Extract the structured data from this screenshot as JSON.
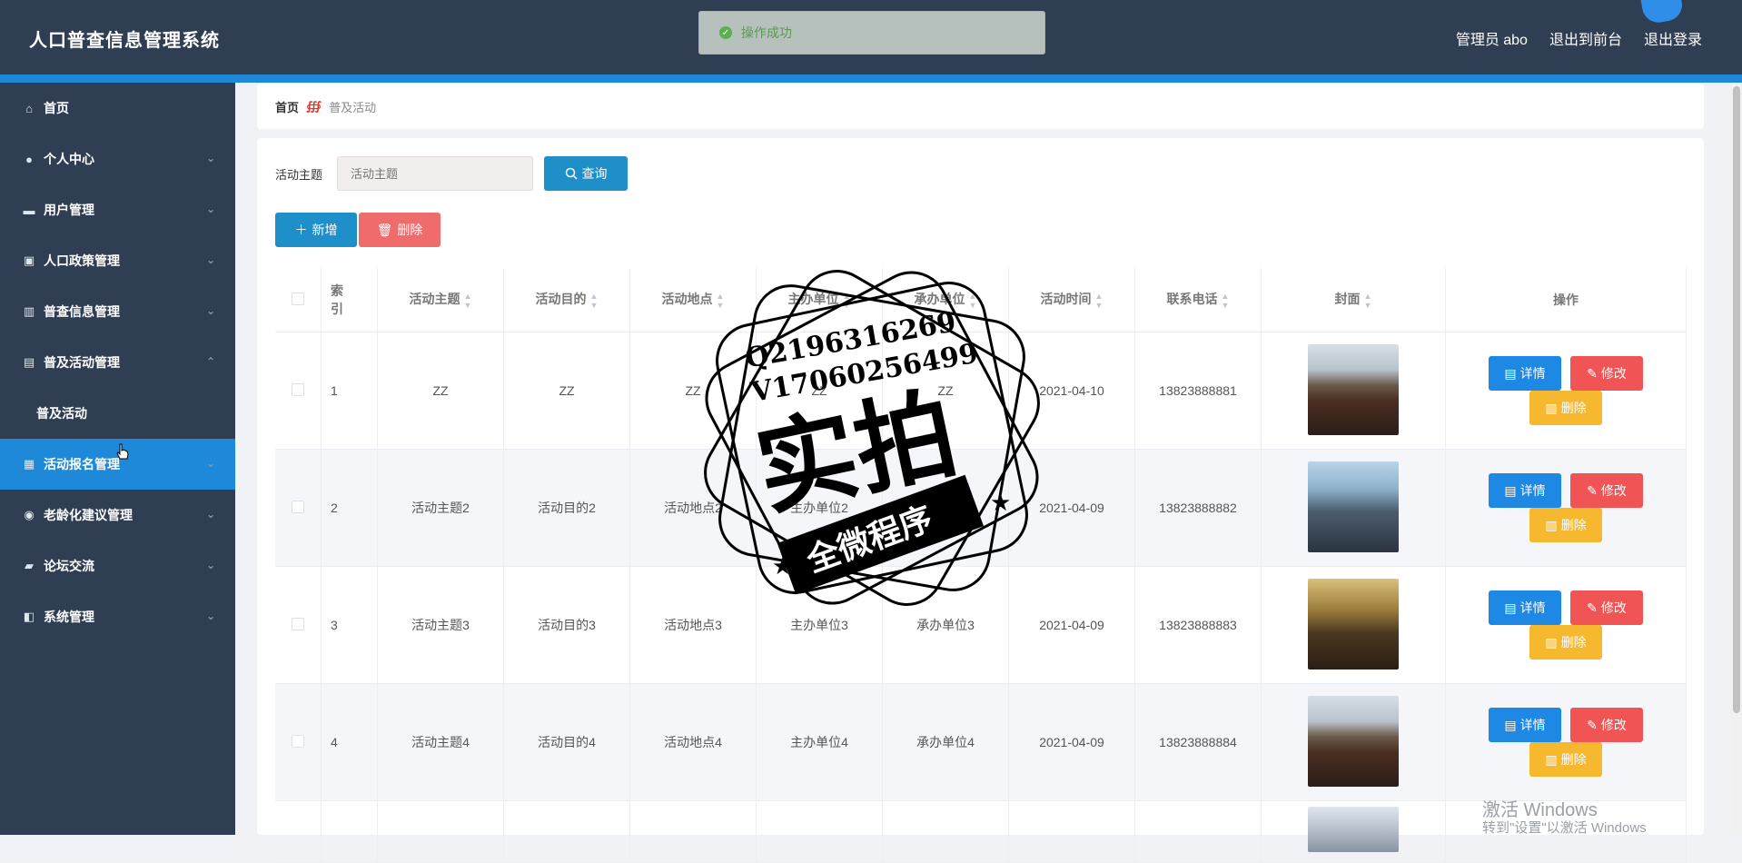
{
  "app": {
    "title": "人口普查信息管理系统"
  },
  "header": {
    "admin_label": "管理员 abo",
    "to_frontend": "退出到前台",
    "logout": "退出登录"
  },
  "toast": {
    "text": "操作成功"
  },
  "sidebar": {
    "items": [
      {
        "label": "首页",
        "icon": "home-icon"
      },
      {
        "label": "个人中心",
        "icon": "user-icon"
      },
      {
        "label": "用户管理",
        "icon": "monitor-icon"
      },
      {
        "label": "人口政策管理",
        "icon": "clipboard-icon"
      },
      {
        "label": "普查信息管理",
        "icon": "chart-icon"
      },
      {
        "label": "普及活动管理",
        "icon": "document-icon"
      },
      {
        "label": "普及活动",
        "icon": ""
      },
      {
        "label": "活动报名管理",
        "icon": "grid-icon"
      },
      {
        "label": "老龄化建议管理",
        "icon": "pin-icon"
      },
      {
        "label": "论坛交流",
        "icon": "briefcase-icon"
      },
      {
        "label": "系统管理",
        "icon": "settings-icon"
      }
    ]
  },
  "breadcrumb": {
    "home": "首页",
    "current": "普及活动"
  },
  "search": {
    "label": "活动主题",
    "placeholder": "活动主题",
    "button": "查询"
  },
  "toolbar": {
    "add": "新增",
    "delete": "删除"
  },
  "table": {
    "headers": [
      "索引",
      "活动主题",
      "活动目的",
      "活动地点",
      "主办单位",
      "承办单位",
      "活动时间",
      "联系电话",
      "封面",
      "操作"
    ],
    "rows": [
      {
        "index": "1",
        "theme": "ZZ",
        "purpose": "ZZ",
        "location": "ZZ",
        "organizer": "ZZ",
        "co_organizer": "ZZ",
        "time": "2021-04-10",
        "phone": "13823888881"
      },
      {
        "index": "2",
        "theme": "活动主题2",
        "purpose": "活动目的2",
        "location": "活动地点2",
        "organizer": "主办单位2",
        "co_organizer": "承办单位2",
        "time": "2021-04-09",
        "phone": "13823888882"
      },
      {
        "index": "3",
        "theme": "活动主题3",
        "purpose": "活动目的3",
        "location": "活动地点3",
        "organizer": "主办单位3",
        "co_organizer": "承办单位3",
        "time": "2021-04-09",
        "phone": "13823888883"
      },
      {
        "index": "4",
        "theme": "活动主题4",
        "purpose": "活动目的4",
        "location": "活动地点4",
        "organizer": "主办单位4",
        "co_organizer": "承办单位4",
        "time": "2021-04-09",
        "phone": "13823888884"
      }
    ],
    "actions": {
      "detail": "详情",
      "edit": "修改",
      "delete": "删除"
    }
  },
  "watermark": {
    "line1": "Q2196316269",
    "line2": "V17060256499",
    "big": "实拍",
    "ribbon": "全微程序"
  },
  "windows_activation": {
    "line1": "激活 Windows",
    "line2": "转到\"设置\"以激活 Windows"
  },
  "colors": {
    "header_bg": "#2f3e52",
    "accent": "#1e89d8",
    "danger": "#f05454",
    "warning": "#f5b82e"
  }
}
